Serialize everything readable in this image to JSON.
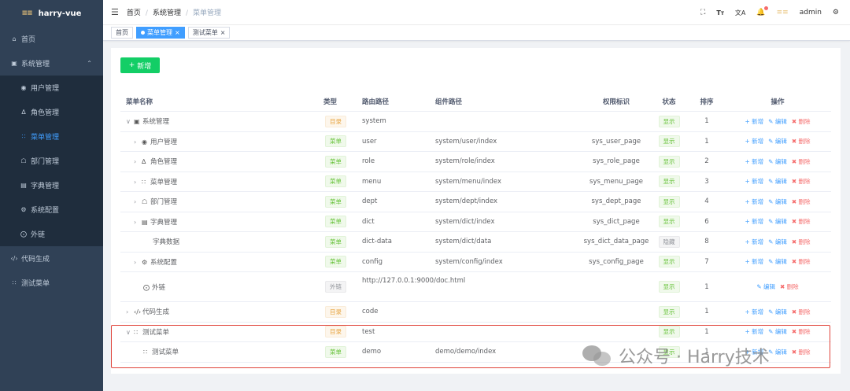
{
  "app": {
    "title": "harry-vue"
  },
  "sidebar": {
    "items": [
      {
        "label": "首页",
        "icon": "home-icon",
        "level": 0
      },
      {
        "label": "系统管理",
        "icon": "monitor-icon",
        "level": 0,
        "expanded": true
      },
      {
        "label": "用户管理",
        "icon": "user-circle-icon",
        "level": 1
      },
      {
        "label": "角色管理",
        "icon": "people-icon",
        "level": 1
      },
      {
        "label": "菜单管理",
        "icon": "grid-icon",
        "level": 1,
        "active": true
      },
      {
        "label": "部门管理",
        "icon": "tree-icon",
        "level": 1
      },
      {
        "label": "字典管理",
        "icon": "book-icon",
        "level": 1
      },
      {
        "label": "系统配置",
        "icon": "gear-icon",
        "level": 1
      },
      {
        "label": "外链",
        "icon": "link-icon",
        "level": 1
      },
      {
        "label": "代码生成",
        "icon": "code-icon",
        "level": 0
      },
      {
        "label": "测试菜单",
        "icon": "grid-icon",
        "level": 0
      }
    ]
  },
  "header": {
    "breadcrumb": [
      "首页",
      "系统管理",
      "菜单管理"
    ],
    "user": "admin"
  },
  "tabs": [
    {
      "label": "首页",
      "active": false,
      "closable": false
    },
    {
      "label": "菜单管理",
      "active": true,
      "closable": true
    },
    {
      "label": "测试菜单",
      "active": false,
      "closable": true
    }
  ],
  "toolbar": {
    "add_label": "新增"
  },
  "table": {
    "headers": {
      "name": "菜单名称",
      "type": "类型",
      "path": "路由路径",
      "component": "组件路径",
      "perm": "权限标识",
      "status": "状态",
      "sort": "排序",
      "ops": "操作"
    },
    "rows": [
      {
        "name": "系统管理",
        "icon": "monitor-icon",
        "level": 0,
        "arrow": "expanded",
        "type": "目录",
        "path": "system",
        "component": "",
        "perm": "",
        "status": "显示",
        "sort": "1",
        "ops": [
          "新增",
          "编辑",
          "删除"
        ]
      },
      {
        "name": "用户管理",
        "icon": "user-circle-icon",
        "level": 1,
        "arrow": "collapsed",
        "type": "菜单",
        "path": "user",
        "component": "system/user/index",
        "perm": "sys_user_page",
        "status": "显示",
        "sort": "1",
        "ops": [
          "新增",
          "编辑",
          "删除"
        ]
      },
      {
        "name": "角色管理",
        "icon": "people-icon",
        "level": 1,
        "arrow": "collapsed",
        "type": "菜单",
        "path": "role",
        "component": "system/role/index",
        "perm": "sys_role_page",
        "status": "显示",
        "sort": "2",
        "ops": [
          "新增",
          "编辑",
          "删除"
        ]
      },
      {
        "name": "菜单管理",
        "icon": "grid-icon",
        "level": 1,
        "arrow": "collapsed",
        "type": "菜单",
        "path": "menu",
        "component": "system/menu/index",
        "perm": "sys_menu_page",
        "status": "显示",
        "sort": "3",
        "ops": [
          "新增",
          "编辑",
          "删除"
        ]
      },
      {
        "name": "部门管理",
        "icon": "tree-icon",
        "level": 1,
        "arrow": "collapsed",
        "type": "菜单",
        "path": "dept",
        "component": "system/dept/index",
        "perm": "sys_dept_page",
        "status": "显示",
        "sort": "4",
        "ops": [
          "新增",
          "编辑",
          "删除"
        ]
      },
      {
        "name": "字典管理",
        "icon": "book-icon",
        "level": 1,
        "arrow": "collapsed",
        "type": "菜单",
        "path": "dict",
        "component": "system/dict/index",
        "perm": "sys_dict_page",
        "status": "显示",
        "sort": "6",
        "ops": [
          "新增",
          "编辑",
          "删除"
        ]
      },
      {
        "name": "字典数据",
        "icon": "",
        "level": 1,
        "arrow": "none",
        "type": "菜单",
        "path": "dict-data",
        "component": "system/dict/data",
        "perm": "sys_dict_data_page",
        "status": "隐藏",
        "sort": "8",
        "ops": [
          "新增",
          "编辑",
          "删除"
        ]
      },
      {
        "name": "系统配置",
        "icon": "gear-icon",
        "level": 1,
        "arrow": "collapsed",
        "type": "菜单",
        "path": "config",
        "component": "system/config/index",
        "perm": "sys_config_page",
        "status": "显示",
        "sort": "7",
        "ops": [
          "新增",
          "编辑",
          "删除"
        ]
      },
      {
        "name": "外链",
        "icon": "link-icon",
        "level": 1,
        "arrow": "none",
        "type": "外链",
        "path": "http://127.0.0.1:9000/doc.html",
        "component": "",
        "perm": "",
        "status": "显示",
        "sort": "1",
        "ops": [
          "编辑",
          "删除"
        ],
        "tall": true
      },
      {
        "name": "代码生成",
        "icon": "code-icon",
        "level": 0,
        "arrow": "collapsed",
        "type": "目录",
        "path": "code",
        "component": "",
        "perm": "",
        "status": "显示",
        "sort": "1",
        "ops": [
          "新增",
          "编辑",
          "删除"
        ]
      },
      {
        "name": "测试菜单",
        "icon": "grid-icon",
        "level": 0,
        "arrow": "expanded",
        "type": "目录",
        "path": "test",
        "component": "",
        "perm": "",
        "status": "显示",
        "sort": "1",
        "ops": [
          "新增",
          "编辑",
          "删除"
        ]
      },
      {
        "name": "测试菜单",
        "icon": "grid-icon",
        "level": 1,
        "arrow": "none",
        "type": "菜单",
        "path": "demo",
        "component": "demo/demo/index",
        "perm": "",
        "status": "显示",
        "sort": "1",
        "ops": [
          "新增",
          "编辑",
          "删除"
        ]
      }
    ]
  },
  "watermark": {
    "text": "公众号 · Harry技术"
  }
}
